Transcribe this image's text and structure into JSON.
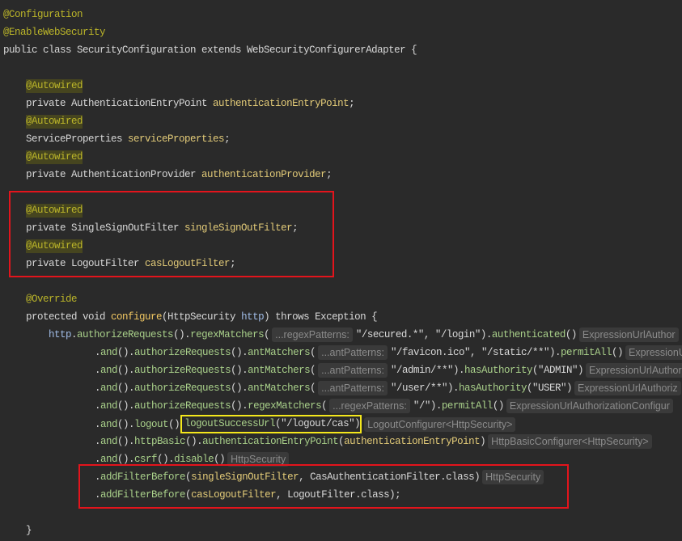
{
  "editor": {
    "lines": [
      [
        "@Configuration"
      ],
      [
        "@EnableWebSecurity"
      ],
      [
        "public class SecurityConfiguration extends WebSecurityConfigurerAdapter {"
      ],
      [
        "@Autowired"
      ],
      [
        "private AuthenticationEntryPoint ",
        "authenticationEntryPoint",
        ";"
      ],
      [
        "@Autowired"
      ],
      [
        "ServiceProperties ",
        "serviceProperties",
        ";"
      ],
      [
        "@Autowired"
      ],
      [
        "private AuthenticationProvider ",
        "authenticationProvider",
        ";"
      ],
      [
        "@Autowired"
      ],
      [
        "private SingleSignOutFilter ",
        "singleSignOutFilter",
        ";"
      ],
      [
        "@Autowired"
      ],
      [
        "private LogoutFilter ",
        "casLogoutFilter",
        ";"
      ],
      [
        "@Override"
      ],
      [
        "protected void ",
        "configure",
        "(HttpSecurity ",
        "http",
        ") throws Exception {"
      ],
      [
        "http",
        ".",
        "authorizeRequests",
        "().",
        "regexMatchers",
        "(",
        "...regexPatterns:",
        "\"/secured.*\", \"/login\").",
        "authenticated",
        "()",
        "ExpressionUrlAuthor"
      ],
      [
        ".",
        "and",
        "().",
        "authorizeRequests",
        "().",
        "antMatchers",
        "(",
        "...antPatterns:",
        "\"/favicon.ico\", \"/static/**\").",
        "permitAll",
        "()",
        "ExpressionU"
      ],
      [
        ".",
        "and",
        "().",
        "authorizeRequests",
        "().",
        "antMatchers",
        "(",
        "...antPatterns:",
        "\"/admin/**\").",
        "hasAuthority",
        "(\"ADMIN\")",
        "ExpressionUrlAuthori"
      ],
      [
        ".",
        "and",
        "().",
        "authorizeRequests",
        "().",
        "antMatchers",
        "(",
        "...antPatterns:",
        "\"/user/**\").",
        "hasAuthority",
        "(\"USER\")",
        "ExpressionUrlAuthoriz"
      ],
      [
        ".",
        "and",
        "().",
        "authorizeRequests",
        "().",
        "regexMatchers",
        "(",
        "...regexPatterns:",
        "\"/\").",
        "permitAll",
        "()",
        "ExpressionUrlAuthorizationConfigur"
      ],
      [
        ".",
        "and",
        "().",
        "logout",
        "()",
        "logoutSuccessUrl",
        "(\"/logout/cas\")",
        "LogoutConfigurer<HttpSecurity>"
      ],
      [
        ".",
        "and",
        "().",
        "httpBasic",
        "().",
        "authenticationEntryPoint",
        "(",
        "authenticationEntryPoint",
        ")",
        "HttpBasicConfigurer<HttpSecurity>"
      ],
      [
        ".",
        "and",
        "().",
        "csrf",
        "().",
        "disable",
        "()",
        "HttpSecurity"
      ],
      [
        ".",
        "addFilterBefore",
        "(",
        "singleSignOutFilter",
        ", CasAuthenticationFilter.class)",
        "HttpSecurity"
      ],
      [
        ".",
        "addFilterBefore",
        "(",
        "casLogoutFilter",
        ", LogoutFilter.class);"
      ],
      [
        "}"
      ]
    ]
  },
  "colors": {
    "background": "#2a2a2a",
    "annotation": "#bbb529",
    "highlight_red": "#e3141c",
    "highlight_yellow": "#f4e71c"
  }
}
